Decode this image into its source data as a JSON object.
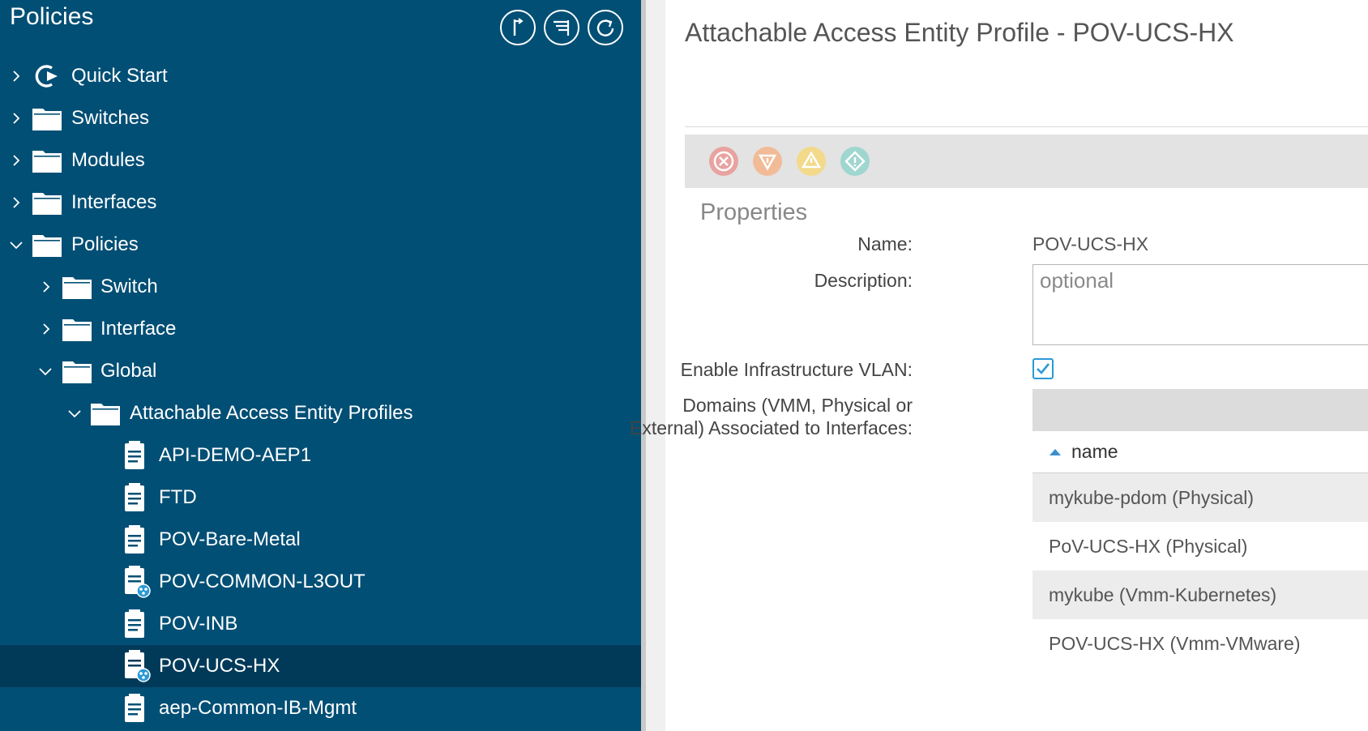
{
  "nav": {
    "title": "Policies",
    "tree": [
      {
        "label": "Quick Start",
        "icon": "quick-start-icon",
        "expander": "collapsed",
        "level": 0
      },
      {
        "label": "Switches",
        "icon": "folder-icon",
        "expander": "collapsed",
        "level": 0
      },
      {
        "label": "Modules",
        "icon": "folder-icon",
        "expander": "collapsed",
        "level": 0
      },
      {
        "label": "Interfaces",
        "icon": "folder-icon",
        "expander": "collapsed",
        "level": 0
      },
      {
        "label": "Policies",
        "icon": "folder-icon",
        "expander": "expanded",
        "level": 0
      },
      {
        "label": "Switch",
        "icon": "folder-icon",
        "expander": "collapsed",
        "level": 1
      },
      {
        "label": "Interface",
        "icon": "folder-icon",
        "expander": "collapsed",
        "level": 1
      },
      {
        "label": "Global",
        "icon": "folder-icon",
        "expander": "expanded",
        "level": 1
      },
      {
        "label": "Attachable Access Entity Profiles",
        "icon": "folder-icon",
        "expander": "expanded",
        "level": 2
      },
      {
        "label": "API-DEMO-AEP1",
        "icon": "document-icon",
        "expander": "none",
        "level": 3
      },
      {
        "label": "FTD",
        "icon": "document-icon",
        "expander": "none",
        "level": 3
      },
      {
        "label": "POV-Bare-Metal",
        "icon": "document-icon",
        "expander": "none",
        "level": 3
      },
      {
        "label": "POV-COMMON-L3OUT",
        "icon": "document-shared-icon",
        "expander": "none",
        "level": 3
      },
      {
        "label": "POV-INB",
        "icon": "document-icon",
        "expander": "none",
        "level": 3
      },
      {
        "label": "POV-UCS-HX",
        "icon": "document-shared-icon",
        "expander": "none",
        "level": 3,
        "selected": true
      },
      {
        "label": "aep-Common-IB-Mgmt",
        "icon": "document-icon",
        "expander": "none",
        "level": 3
      }
    ]
  },
  "content": {
    "title": "Attachable Access Entity Profile - POV-UCS-HX",
    "faults": [
      {
        "icon": "critical-fault-icon",
        "color": "#e8a3a0"
      },
      {
        "icon": "major-fault-icon",
        "color": "#f2bb97"
      },
      {
        "icon": "minor-fault-icon",
        "color": "#f3d98a"
      },
      {
        "icon": "warning-fault-icon",
        "color": "#9fd6cf"
      }
    ],
    "section_title": "Properties",
    "name_label": "Name:",
    "name_value": "POV-UCS-HX",
    "description_label": "Description:",
    "description_placeholder": "optional",
    "infra_vlan_label": "Enable Infrastructure VLAN:",
    "infra_vlan_checked": true,
    "domains_label_line1": "Domains (VMM, Physical or",
    "domains_label_line2": "External) Associated to Interfaces:",
    "domains_table": {
      "column": "name",
      "sort": "ascending",
      "rows": [
        "mykube-pdom (Physical)",
        "PoV-UCS-HX (Physical)",
        "mykube (Vmm-Kubernetes)",
        "POV-UCS-HX (Vmm-VMware)"
      ]
    }
  },
  "colors": {
    "nav_bg": "#024f75",
    "nav_selected": "#013a59",
    "checkbox_accent": "#2b9ad6"
  }
}
